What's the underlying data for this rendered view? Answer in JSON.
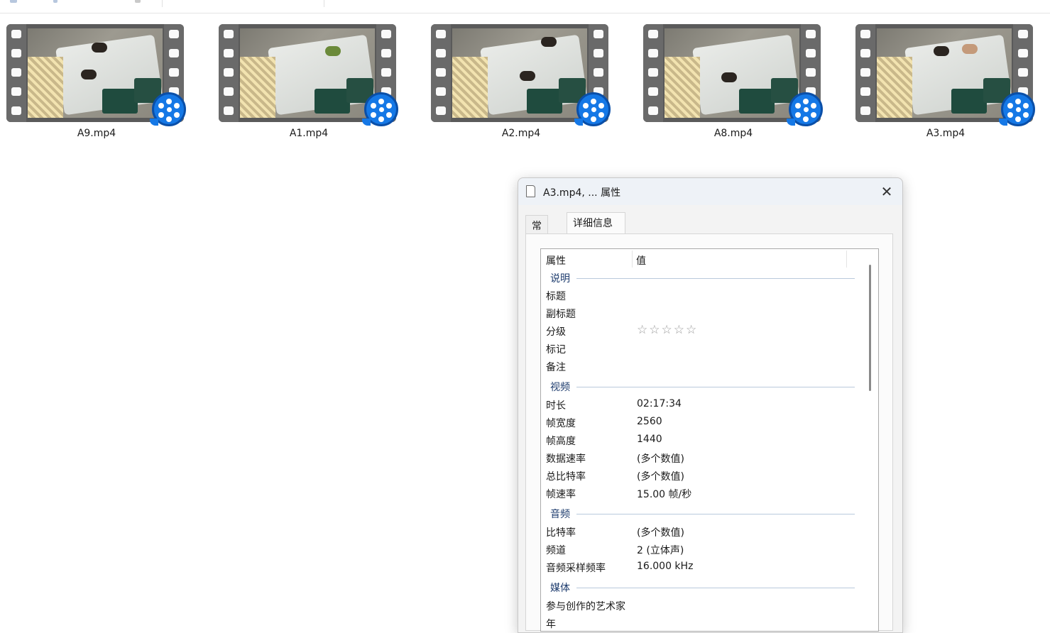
{
  "files": [
    {
      "name": "A9.mp4"
    },
    {
      "name": "A1.mp4"
    },
    {
      "name": "A2.mp4"
    },
    {
      "name": "A8.mp4"
    },
    {
      "name": "A3.mp4"
    }
  ],
  "dialog": {
    "title": "A3.mp4, ... 属性",
    "close_glyph": "✕",
    "tabs": [
      {
        "label": "常规"
      },
      {
        "label": "详细信息"
      }
    ],
    "columns": {
      "property": "属性",
      "value": "值"
    },
    "groups": {
      "description": {
        "label": "说明",
        "rows": [
          {
            "key": "标题",
            "value": ""
          },
          {
            "key": "副标题",
            "value": ""
          },
          {
            "key": "分级",
            "value": "☆☆☆☆☆",
            "rating": 0,
            "max_rating": 5
          },
          {
            "key": "标记",
            "value": ""
          },
          {
            "key": "备注",
            "value": ""
          }
        ]
      },
      "video": {
        "label": "视频",
        "rows": [
          {
            "key": "时长",
            "value": "02:17:34"
          },
          {
            "key": "帧宽度",
            "value": "2560"
          },
          {
            "key": "帧高度",
            "value": "1440"
          },
          {
            "key": "数据速率",
            "value": "(多个数值)"
          },
          {
            "key": "总比特率",
            "value": "(多个数值)"
          },
          {
            "key": "帧速率",
            "value": "15.00 帧/秒"
          }
        ]
      },
      "audio": {
        "label": "音频",
        "rows": [
          {
            "key": "比特率",
            "value": "(多个数值)"
          },
          {
            "key": "频道",
            "value": "2 (立体声)"
          },
          {
            "key": "音频采样频率",
            "value": "16.000 kHz"
          }
        ]
      },
      "media": {
        "label": "媒体",
        "rows": [
          {
            "key": "参与创作的艺术家",
            "value": ""
          },
          {
            "key": "年",
            "value": ""
          }
        ]
      }
    }
  },
  "icons": {
    "file_type": "video-film-icon",
    "app_badge": "media-player-badge-icon",
    "title": "document-icon",
    "close": "close-icon"
  },
  "colors": {
    "badge_blue": "#1578e6",
    "group_label": "#1e3c6e",
    "dialog_bg": "#f3f3f3"
  }
}
